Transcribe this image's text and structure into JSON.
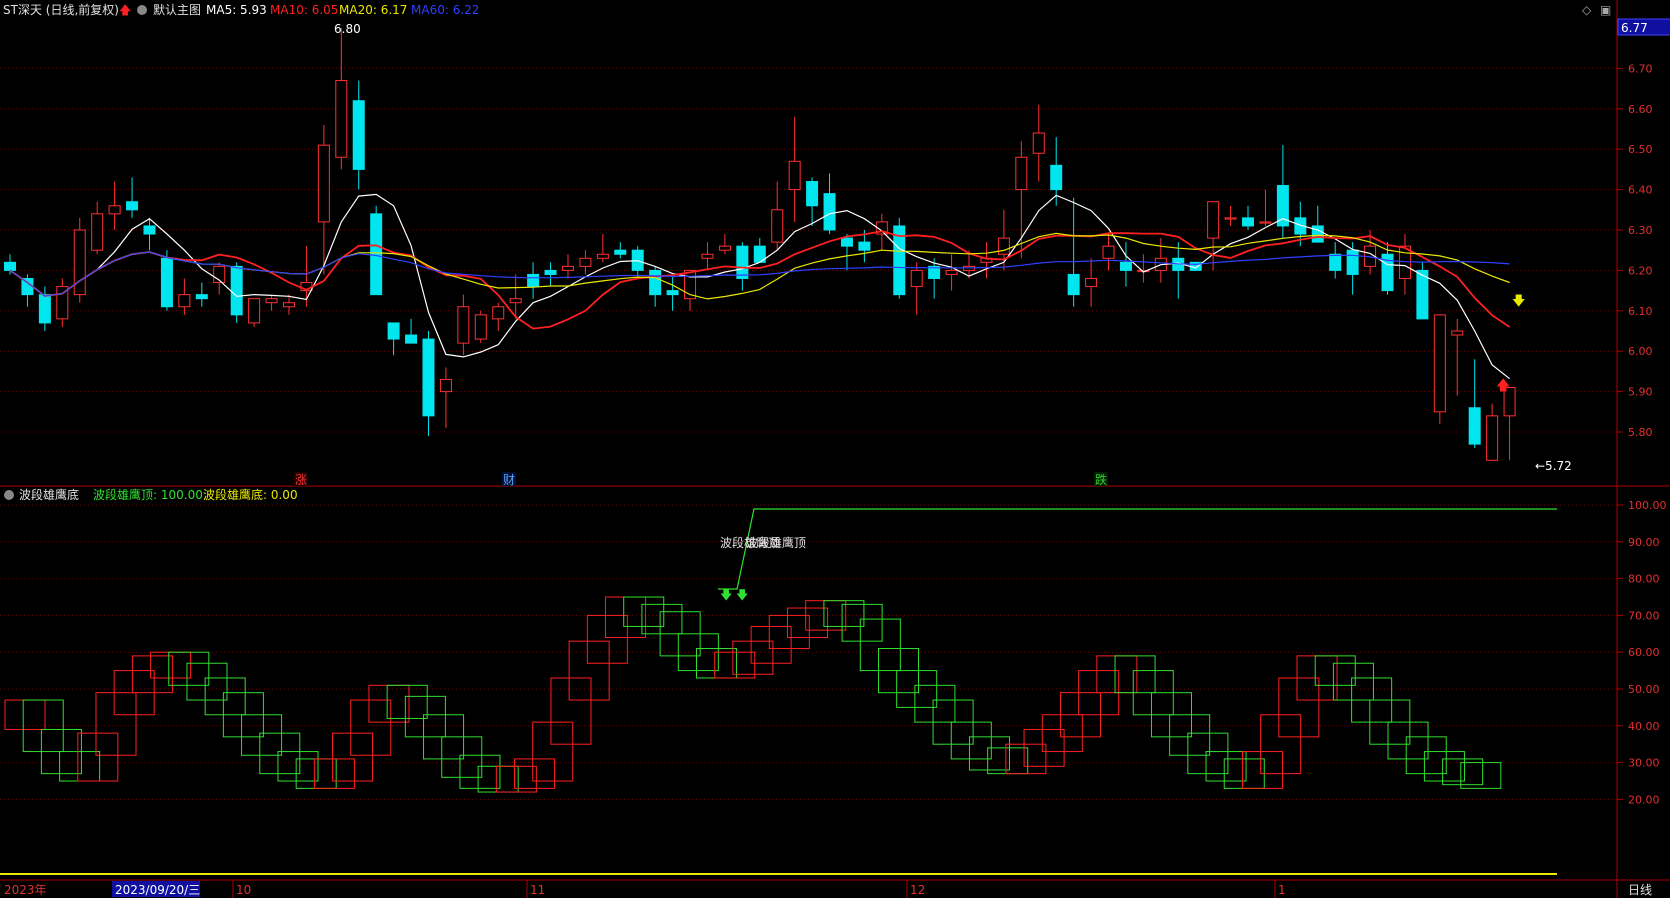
{
  "main_header": {
    "title": "ST深天 (日线,前复权)",
    "template": "默认主图",
    "ma5": "MA5: 5.93",
    "ma10": "MA10: 6.05",
    "ma20": "MA20: 6.17",
    "ma60": "MA60: 6.22"
  },
  "price_badge": "6.77",
  "price_axis": [
    "6.70",
    "6.60",
    "6.50",
    "6.40",
    "6.30",
    "6.20",
    "6.10",
    "6.00",
    "5.90",
    "5.80"
  ],
  "annotations": {
    "high": "6.80",
    "low": "←5.72"
  },
  "event_markers": [
    {
      "label": "涨",
      "color": "#ff3030"
    },
    {
      "label": "财",
      "color": "#5aa0ff"
    },
    {
      "label": "跌",
      "color": "#30d030"
    }
  ],
  "sub_header": {
    "title": "波段雄鹰底",
    "top": "波段雄鹰顶: 100.00",
    "bottom": "波段雄鹰底: 0.00"
  },
  "sub_note": "波段雄鹰顶",
  "sub_axis": [
    "100.00",
    "90.00",
    "80.00",
    "70.00",
    "60.00",
    "50.00",
    "40.00",
    "30.00",
    "20.00"
  ],
  "date_axis": {
    "year": "2023年",
    "cursor_date": "2023/09/20/三",
    "months": [
      "10",
      "11",
      "12",
      "1"
    ],
    "period": "日线"
  },
  "chart_data": {
    "type": "candlestick",
    "series": [
      {
        "name": "MA5",
        "color": "#ffffff"
      },
      {
        "name": "MA10",
        "color": "#ff2020"
      },
      {
        "name": "MA20",
        "color": "#e8e800"
      },
      {
        "name": "MA60",
        "color": "#3040ff"
      }
    ],
    "y_range": [
      5.72,
      6.8
    ],
    "last": 5.93
  },
  "colors": {
    "up": "#ff3030",
    "down": "#00e5ee",
    "grid": "#7a0000"
  }
}
